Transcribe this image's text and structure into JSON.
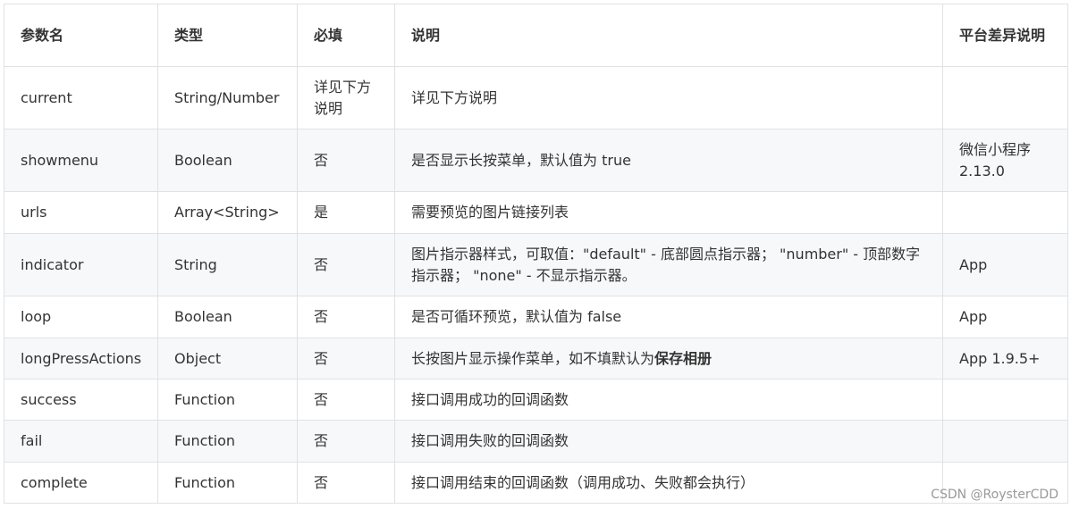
{
  "table": {
    "headers": [
      "参数名",
      "类型",
      "必填",
      "说明",
      "平台差异说明"
    ],
    "rows": [
      {
        "name": "current",
        "type": "String/Number",
        "required": "详见下方说明",
        "desc": "详见下方说明",
        "desc_bold": "",
        "platform": ""
      },
      {
        "name": "showmenu",
        "type": "Boolean",
        "required": "否",
        "desc": "是否显示长按菜单，默认值为 true",
        "desc_bold": "",
        "platform": "微信小程序 2.13.0"
      },
      {
        "name": "urls",
        "type": "Array<String>",
        "required": "是",
        "desc": "需要预览的图片链接列表",
        "desc_bold": "",
        "platform": ""
      },
      {
        "name": "indicator",
        "type": "String",
        "required": "否",
        "desc": "图片指示器样式，可取值：\"default\" - 底部圆点指示器； \"number\" - 顶部数字指示器； \"none\" - 不显示指示器。",
        "desc_bold": "",
        "platform": "App"
      },
      {
        "name": "loop",
        "type": "Boolean",
        "required": "否",
        "desc": "是否可循环预览，默认值为 false",
        "desc_bold": "",
        "platform": "App"
      },
      {
        "name": "longPressActions",
        "type": "Object",
        "required": "否",
        "desc": "长按图片显示操作菜单，如不填默认为",
        "desc_bold": "保存相册",
        "platform": "App 1.9.5+"
      },
      {
        "name": "success",
        "type": "Function",
        "required": "否",
        "desc": "接口调用成功的回调函数",
        "desc_bold": "",
        "platform": ""
      },
      {
        "name": "fail",
        "type": "Function",
        "required": "否",
        "desc": "接口调用失败的回调函数",
        "desc_bold": "",
        "platform": ""
      },
      {
        "name": "complete",
        "type": "Function",
        "required": "否",
        "desc": "接口调用结束的回调函数（调用成功、失败都会执行）",
        "desc_bold": "",
        "platform": ""
      }
    ]
  },
  "watermark": "CSDN @RoysterCDD"
}
